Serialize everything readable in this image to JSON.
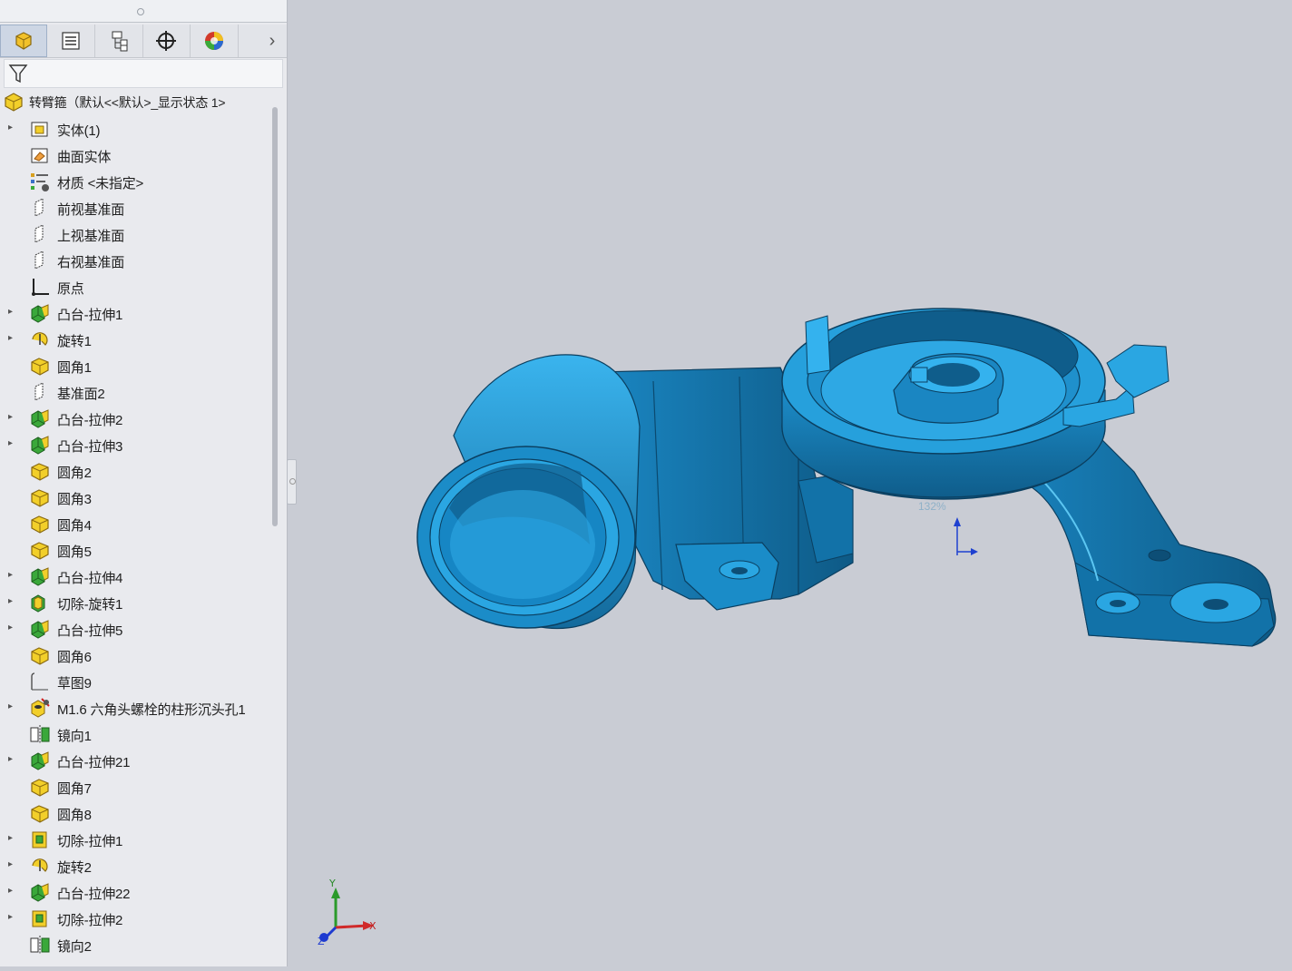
{
  "feature_tree": {
    "root": {
      "label": "转臂箍（默认<<默认>_显示状态 1>",
      "icon": "part-icon"
    },
    "items": [
      {
        "label": "实体(1)",
        "icon": "solid-bodies-icon",
        "expandable": true
      },
      {
        "label": "曲面实体",
        "icon": "surface-bodies-icon",
        "expandable": false
      },
      {
        "label": "材质 <未指定>",
        "icon": "material-icon",
        "expandable": false
      },
      {
        "label": "前视基准面",
        "icon": "plane-icon",
        "expandable": false
      },
      {
        "label": "上视基准面",
        "icon": "plane-icon",
        "expandable": false
      },
      {
        "label": "右视基准面",
        "icon": "plane-icon",
        "expandable": false
      },
      {
        "label": "原点",
        "icon": "origin-icon",
        "expandable": false
      },
      {
        "label": "凸台-拉伸1",
        "icon": "boss-extrude-icon",
        "expandable": true
      },
      {
        "label": "旋转1",
        "icon": "revolve-icon",
        "expandable": true
      },
      {
        "label": "圆角1",
        "icon": "fillet-icon",
        "expandable": false
      },
      {
        "label": "基准面2",
        "icon": "plane-icon",
        "expandable": false
      },
      {
        "label": "凸台-拉伸2",
        "icon": "boss-extrude-icon",
        "expandable": true
      },
      {
        "label": "凸台-拉伸3",
        "icon": "boss-extrude-icon",
        "expandable": true
      },
      {
        "label": "圆角2",
        "icon": "fillet-icon",
        "expandable": false
      },
      {
        "label": "圆角3",
        "icon": "fillet-icon",
        "expandable": false
      },
      {
        "label": "圆角4",
        "icon": "fillet-icon",
        "expandable": false
      },
      {
        "label": "圆角5",
        "icon": "fillet-icon",
        "expandable": false
      },
      {
        "label": "凸台-拉伸4",
        "icon": "boss-extrude-icon",
        "expandable": true
      },
      {
        "label": "切除-旋转1",
        "icon": "cut-revolve-icon",
        "expandable": true
      },
      {
        "label": "凸台-拉伸5",
        "icon": "boss-extrude-icon",
        "expandable": true
      },
      {
        "label": "圆角6",
        "icon": "fillet-icon",
        "expandable": false
      },
      {
        "label": "草图9",
        "icon": "sketch-icon",
        "expandable": false
      },
      {
        "label": "M1.6 六角头螺栓的柱形沉头孔1",
        "icon": "hole-wizard-icon",
        "expandable": true
      },
      {
        "label": "镜向1",
        "icon": "mirror-icon",
        "expandable": false
      },
      {
        "label": "凸台-拉伸21",
        "icon": "boss-extrude-icon",
        "expandable": true
      },
      {
        "label": "圆角7",
        "icon": "fillet-icon",
        "expandable": false
      },
      {
        "label": "圆角8",
        "icon": "fillet-icon",
        "expandable": false
      },
      {
        "label": "切除-拉伸1",
        "icon": "cut-extrude-icon",
        "expandable": true
      },
      {
        "label": "旋转2",
        "icon": "revolve-icon",
        "expandable": true
      },
      {
        "label": "凸台-拉伸22",
        "icon": "boss-extrude-icon",
        "expandable": true
      },
      {
        "label": "切除-拉伸2",
        "icon": "cut-extrude-icon",
        "expandable": true
      },
      {
        "label": "镜向2",
        "icon": "mirror-icon",
        "expandable": false
      }
    ]
  },
  "tabs": [
    {
      "name": "feature-manager-tab",
      "icon": "feature-manager-icon",
      "active": true
    },
    {
      "name": "property-manager-tab",
      "icon": "property-manager-icon",
      "active": false
    },
    {
      "name": "configuration-manager-tab",
      "icon": "configuration-manager-icon",
      "active": false
    },
    {
      "name": "dimxpert-tab",
      "icon": "dimxpert-icon",
      "active": false
    },
    {
      "name": "display-manager-tab",
      "icon": "display-manager-icon",
      "active": false
    }
  ],
  "viewport": {
    "zoom_label": "132%",
    "triad": {
      "x": "X",
      "y": "Y",
      "z": "Z"
    },
    "model_color": "#1e9bd7",
    "background_color": "#c9ccd4"
  },
  "colors": {
    "feature_yellow": "#f2cf2a",
    "feature_green": "#3aa83a",
    "panel_bg": "#e9eaee"
  }
}
